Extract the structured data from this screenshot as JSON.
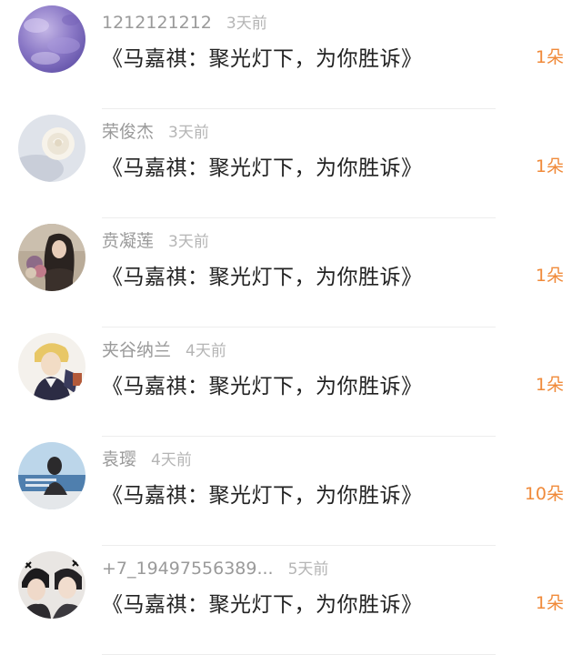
{
  "accent_color": "#f08a3a",
  "comments": [
    {
      "name": "1212121212",
      "time": "3天前",
      "message": "《马嘉祺：聚光灯下，为你胜诉》",
      "count": "1朵",
      "avatar_icon": "purple-marble-avatar"
    },
    {
      "name": "荣俊杰",
      "time": "3天前",
      "message": "《马嘉祺：聚光灯下，为你胜诉》",
      "count": "1朵",
      "avatar_icon": "white-rose-avatar"
    },
    {
      "name": "贲凝莲",
      "time": "3天前",
      "message": "《马嘉祺：聚光灯下，为你胜诉》",
      "count": "1朵",
      "avatar_icon": "girl-with-flowers-avatar"
    },
    {
      "name": "夹谷纳兰",
      "time": "4天前",
      "message": "《马嘉祺：聚光灯下，为你胜诉》",
      "count": "1朵",
      "avatar_icon": "anime-character-avatar"
    },
    {
      "name": "袁璎",
      "time": "4天前",
      "message": "《马嘉祺：聚光灯下，为你胜诉》",
      "count": "10朵",
      "avatar_icon": "seaside-girl-avatar"
    },
    {
      "name": "+7_19497556389...",
      "time": "5天前",
      "message": "《马嘉祺：聚光灯下，为你胜诉》",
      "count": "1朵",
      "avatar_icon": "couple-photo-avatar"
    }
  ]
}
